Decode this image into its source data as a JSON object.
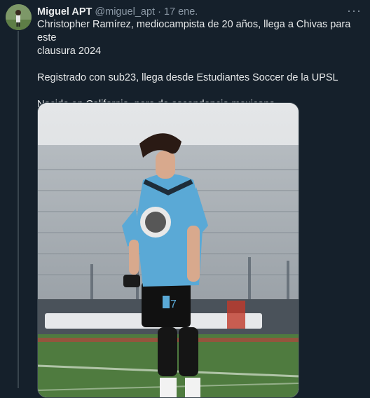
{
  "tweet": {
    "author_name": "Miguel APT",
    "handle": "@miguel_apt",
    "separator": "·",
    "time": "17 ene.",
    "more_label": "···",
    "lines": [
      "Christopher Ramírez, mediocampista de 20 años, llega a Chivas para este",
      "clausura 2024",
      "",
      "Registrado con sub23, llega desde Estudiantes Soccer de la UPSL",
      "",
      "Nacido en California, pero de ascendencia mexicana"
    ],
    "media": {
      "jersey_number": "7"
    }
  },
  "colors": {
    "background": "#15202b",
    "text": "#e7e9ea",
    "secondary": "#8b98a5",
    "jersey": "#5aa9d6"
  }
}
